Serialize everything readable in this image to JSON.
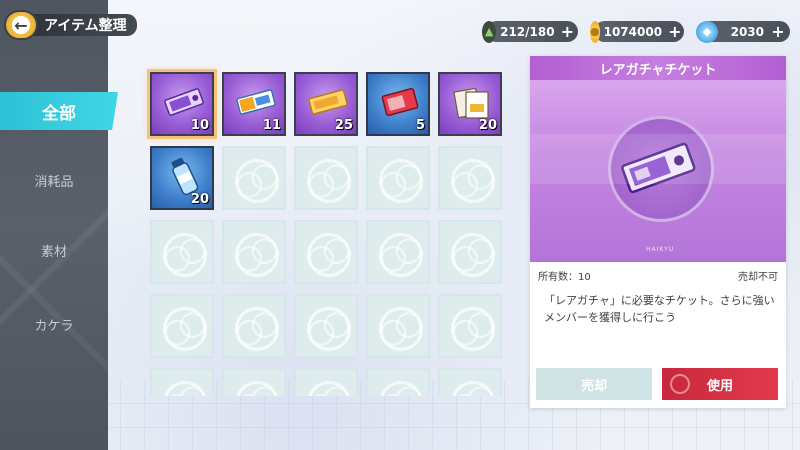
{
  "header": {
    "back_icon": "arrow-left-icon",
    "title": "アイテム整理"
  },
  "currencies": [
    {
      "icon": "stamina-icon",
      "value": "212/180",
      "color": "#6ab04c"
    },
    {
      "icon": "coin-icon",
      "value": "1074000",
      "color": "#f2b632"
    },
    {
      "icon": "crystal-icon",
      "value": "2030",
      "color": "#4aa8e8"
    }
  ],
  "sidebar": {
    "tabs": [
      {
        "label": "全部",
        "active": true
      },
      {
        "label": "消耗品",
        "active": false
      },
      {
        "label": "素材",
        "active": false
      },
      {
        "label": "カケラ",
        "active": false
      }
    ]
  },
  "inventory": {
    "items": [
      {
        "icon": "rare-gacha-ticket-icon",
        "count": "10",
        "rarity": "purple",
        "selected": true
      },
      {
        "icon": "ticket-icon",
        "count": "11",
        "rarity": "purple"
      },
      {
        "icon": "gold-ticket-icon",
        "count": "25",
        "rarity": "purple"
      },
      {
        "icon": "red-ticket-icon",
        "count": "5",
        "rarity": "blue"
      },
      {
        "icon": "documents-icon",
        "count": "20",
        "rarity": "purple"
      },
      {
        "icon": "bottle-icon",
        "count": "20",
        "rarity": "blue"
      }
    ],
    "empty_icon": "volleyball-icon"
  },
  "detail": {
    "title": "レアガチャチケット",
    "art_icon": "rare-gacha-ticket-icon",
    "art_brand": "HAIKYU",
    "owned": "所有数：10",
    "sell_status": "売却不可",
    "description": "「レアガチャ」に必要なチケット。さらに強いメンバーを獲得しに行こう",
    "sell_label": "売却",
    "use_label": "使用"
  }
}
